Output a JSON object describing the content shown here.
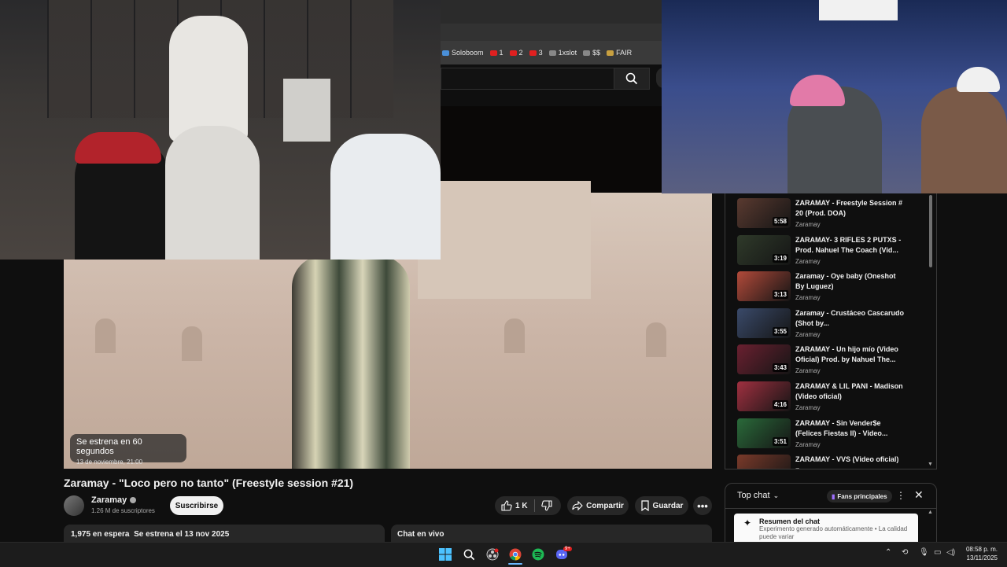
{
  "browser": {
    "bookmarks": [
      {
        "label": "Soloboom",
        "icon": "bookmark-icon",
        "color": "#4a90d9"
      },
      {
        "label": "1",
        "icon": "youtube-icon",
        "color": "#e02020"
      },
      {
        "label": "2",
        "icon": "youtube-icon",
        "color": "#e02020"
      },
      {
        "label": "3",
        "icon": "youtube-icon",
        "color": "#e02020"
      },
      {
        "label": "1xslot",
        "icon": "kick-icon",
        "color": "#888888"
      },
      {
        "label": "$$",
        "icon": "kick-icon",
        "color": "#888888"
      },
      {
        "label": "FAIR",
        "icon": "fair-icon",
        "color": "#c8a040"
      }
    ]
  },
  "video": {
    "premiere_text": "Se estrena en 60 segundos",
    "premiere_date": "13 de noviembre, 21:00",
    "title": "Zaramay - \"Loco pero no tanto\" (Freestyle session #21)"
  },
  "channel": {
    "name": "Zaramay",
    "subscribers": "1.26 M de suscriptores",
    "subscribe_label": "Suscribirse"
  },
  "actions": {
    "likes": "1 K",
    "share_label": "Compartir",
    "save_label": "Guardar"
  },
  "description": {
    "waiting": "1,975 en espera",
    "premiere": "Se estrena el 13 nov 2025"
  },
  "live_chat_label": "Chat en vivo",
  "sidebar": {
    "items": [
      {
        "title": "ZARAMAY - Freestyle Session # 20 (Prod. DOA)",
        "channel": "Zaramay",
        "duration": "5:58",
        "color": "#5a3a30"
      },
      {
        "title": "ZARAMAY- 3 RIFLES 2 PUTXS - Prod. Nahuel The Coach (Vid...",
        "channel": "Zaramay",
        "duration": "3:19",
        "color": "#2f3a2a"
      },
      {
        "title": "Zaramay - Oye baby (Oneshot By Luguez)",
        "channel": "Zaramay",
        "duration": "3:13",
        "color": "#b24a3a"
      },
      {
        "title": "Zaramay - Crustáceo Cascarudo (Shot by...",
        "channel": "Zaramay",
        "duration": "3:55",
        "color": "#3a4a6a"
      },
      {
        "title": "ZARAMAY - Un hijo mío (Video Oficial) Prod. by Nahuel The...",
        "channel": "Zaramay",
        "duration": "3:43",
        "color": "#6a2030"
      },
      {
        "title": "ZARAMAY & LIL PANI - Madison (Video oficial)",
        "channel": "Zaramay",
        "duration": "4:16",
        "color": "#a03040"
      },
      {
        "title": "ZARAMAY - Sin Vender$e (Felices Fiestas II) - Video...",
        "channel": "Zaramay",
        "duration": "3:51",
        "color": "#2a6a3a"
      },
      {
        "title": "ZARAMAY - VVS (Video oficial)",
        "channel": "Zaramay",
        "duration": "",
        "color": "#7a3a2a"
      }
    ]
  },
  "chat": {
    "mode": "Top chat",
    "fans_label": "Fans principales",
    "summary_title": "Resumen del chat",
    "summary_text": "Experimento generado automáticamente • La calidad puede variar"
  },
  "taskbar": {
    "time": "08:58 p. m.",
    "date": "13/11/2025",
    "discord_badge": "9+"
  }
}
